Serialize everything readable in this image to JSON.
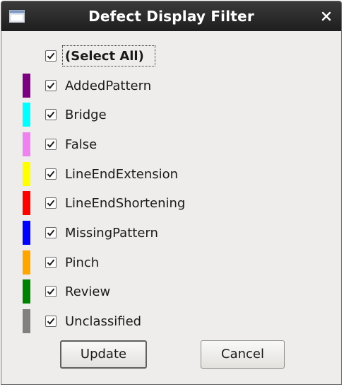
{
  "window": {
    "title": "Defect Display Filter"
  },
  "select_all": {
    "label": "(Select All)",
    "checked": true
  },
  "items": [
    {
      "label": "AddedPattern",
      "color": "#7b0080",
      "checked": true
    },
    {
      "label": "Bridge",
      "color": "#00ffff",
      "checked": true
    },
    {
      "label": "False",
      "color": "#ee82ee",
      "checked": true
    },
    {
      "label": "LineEndExtension",
      "color": "#ffff00",
      "checked": true
    },
    {
      "label": "LineEndShortening",
      "color": "#ff0000",
      "checked": true
    },
    {
      "label": "MissingPattern",
      "color": "#0000ff",
      "checked": true
    },
    {
      "label": "Pinch",
      "color": "#ffa500",
      "checked": true
    },
    {
      "label": "Review",
      "color": "#008000",
      "checked": true
    },
    {
      "label": "Unclassified",
      "color": "#808080",
      "checked": true
    }
  ],
  "buttons": {
    "update": "Update",
    "cancel": "Cancel"
  }
}
